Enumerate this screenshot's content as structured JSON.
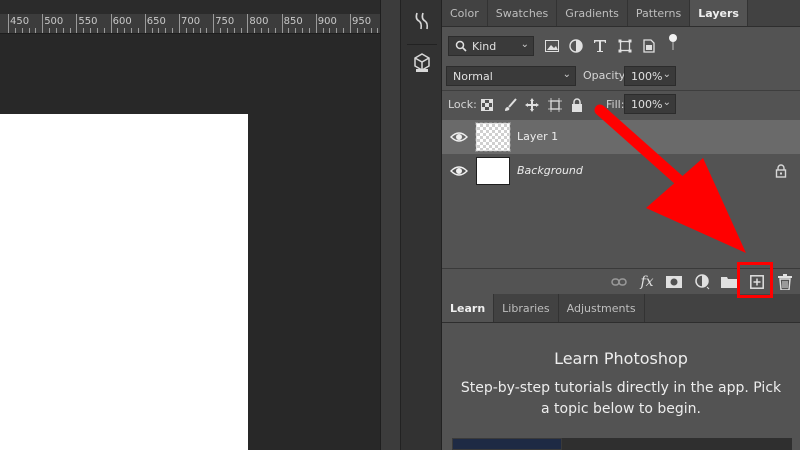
{
  "ruler": {
    "labels": [
      "450",
      "500",
      "550",
      "600",
      "650",
      "700",
      "750",
      "800",
      "850",
      "900",
      "950"
    ]
  },
  "panel_tabs": [
    {
      "label": "Color",
      "active": false
    },
    {
      "label": "Swatches",
      "active": false
    },
    {
      "label": "Gradients",
      "active": false
    },
    {
      "label": "Patterns",
      "active": false
    },
    {
      "label": "Layers",
      "active": true
    }
  ],
  "layers_panel": {
    "filter": {
      "value": "Kind"
    },
    "blend_mode": {
      "value": "Normal"
    },
    "opacity": {
      "label": "Opacity:",
      "value": "100%"
    },
    "lock": {
      "label": "Lock:"
    },
    "fill": {
      "label": "Fill:",
      "value": "100%"
    },
    "layers": [
      {
        "name": "Layer 1",
        "selected": true,
        "visible": true,
        "transparent": true,
        "locked": false
      },
      {
        "name": "Background",
        "selected": false,
        "visible": true,
        "transparent": false,
        "locked": true
      }
    ],
    "footer_icons": [
      "link-icon",
      "fx-icon",
      "mask-icon",
      "adjustment-icon",
      "folder-icon",
      "new-layer-icon",
      "trash-icon"
    ],
    "fx_label": "fx"
  },
  "learn_tabs": [
    {
      "label": "Learn",
      "active": true
    },
    {
      "label": "Libraries",
      "active": false
    },
    {
      "label": "Adjustments",
      "active": false
    }
  ],
  "learn": {
    "title": "Learn Photoshop",
    "description": "Step-by-step tutorials directly in the app. Pick a topic below to begin."
  },
  "colors": {
    "annotation": "#ff0000",
    "panel_bg": "#535353",
    "selected_layer": "#6a6a6a"
  }
}
